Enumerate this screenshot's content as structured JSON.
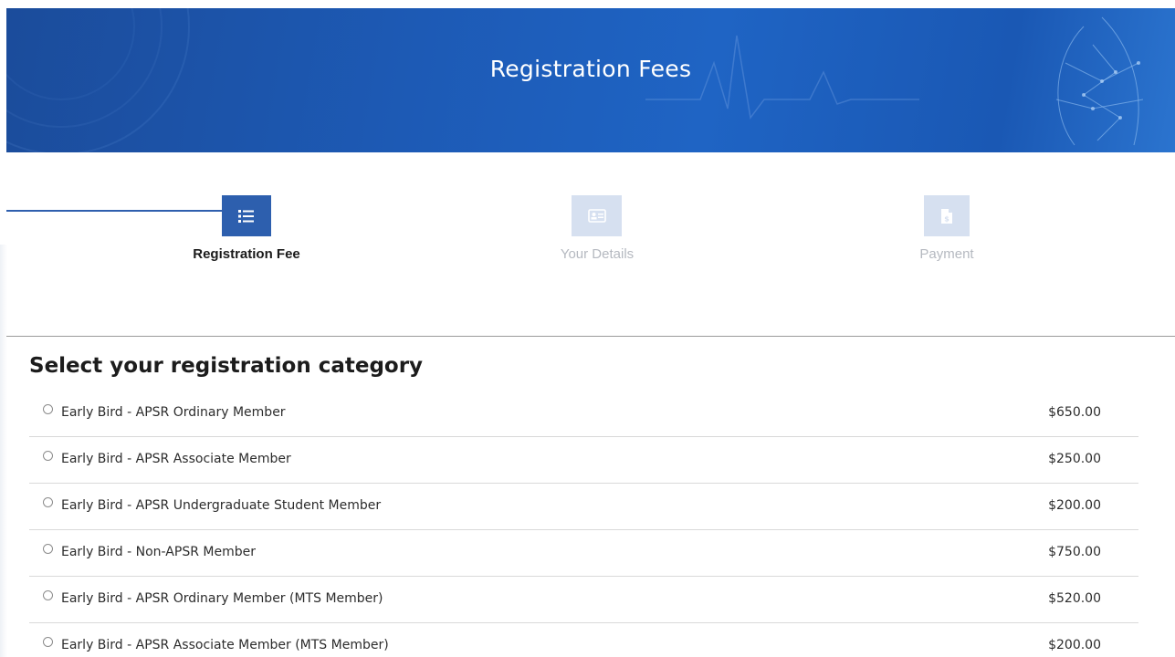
{
  "banner": {
    "title": "Registration Fees"
  },
  "stepper": {
    "steps": [
      {
        "label": "Registration Fee",
        "icon": "list-icon",
        "state": "active"
      },
      {
        "label": "Your Details",
        "icon": "id-card-icon",
        "state": "inactive"
      },
      {
        "label": "Payment",
        "icon": "dollar-document-icon",
        "state": "inactive"
      }
    ]
  },
  "section": {
    "title": "Select your registration category"
  },
  "options": [
    {
      "label": "Early Bird - APSR Ordinary Member",
      "price": "$650.00"
    },
    {
      "label": "Early Bird - APSR Associate Member",
      "price": "$250.00"
    },
    {
      "label": "Early Bird - APSR Undergraduate Student Member",
      "price": "$200.00"
    },
    {
      "label": "Early Bird - Non-APSR Member",
      "price": "$750.00"
    },
    {
      "label": "Early Bird - APSR Ordinary Member (MTS Member)",
      "price": "$520.00"
    },
    {
      "label": "Early Bird - APSR Associate Member (MTS Member)",
      "price": "$200.00"
    }
  ],
  "colors": {
    "primary": "#2d5fae",
    "inactive_step": "#d6e0f0",
    "banner": "#1d5ab5"
  }
}
